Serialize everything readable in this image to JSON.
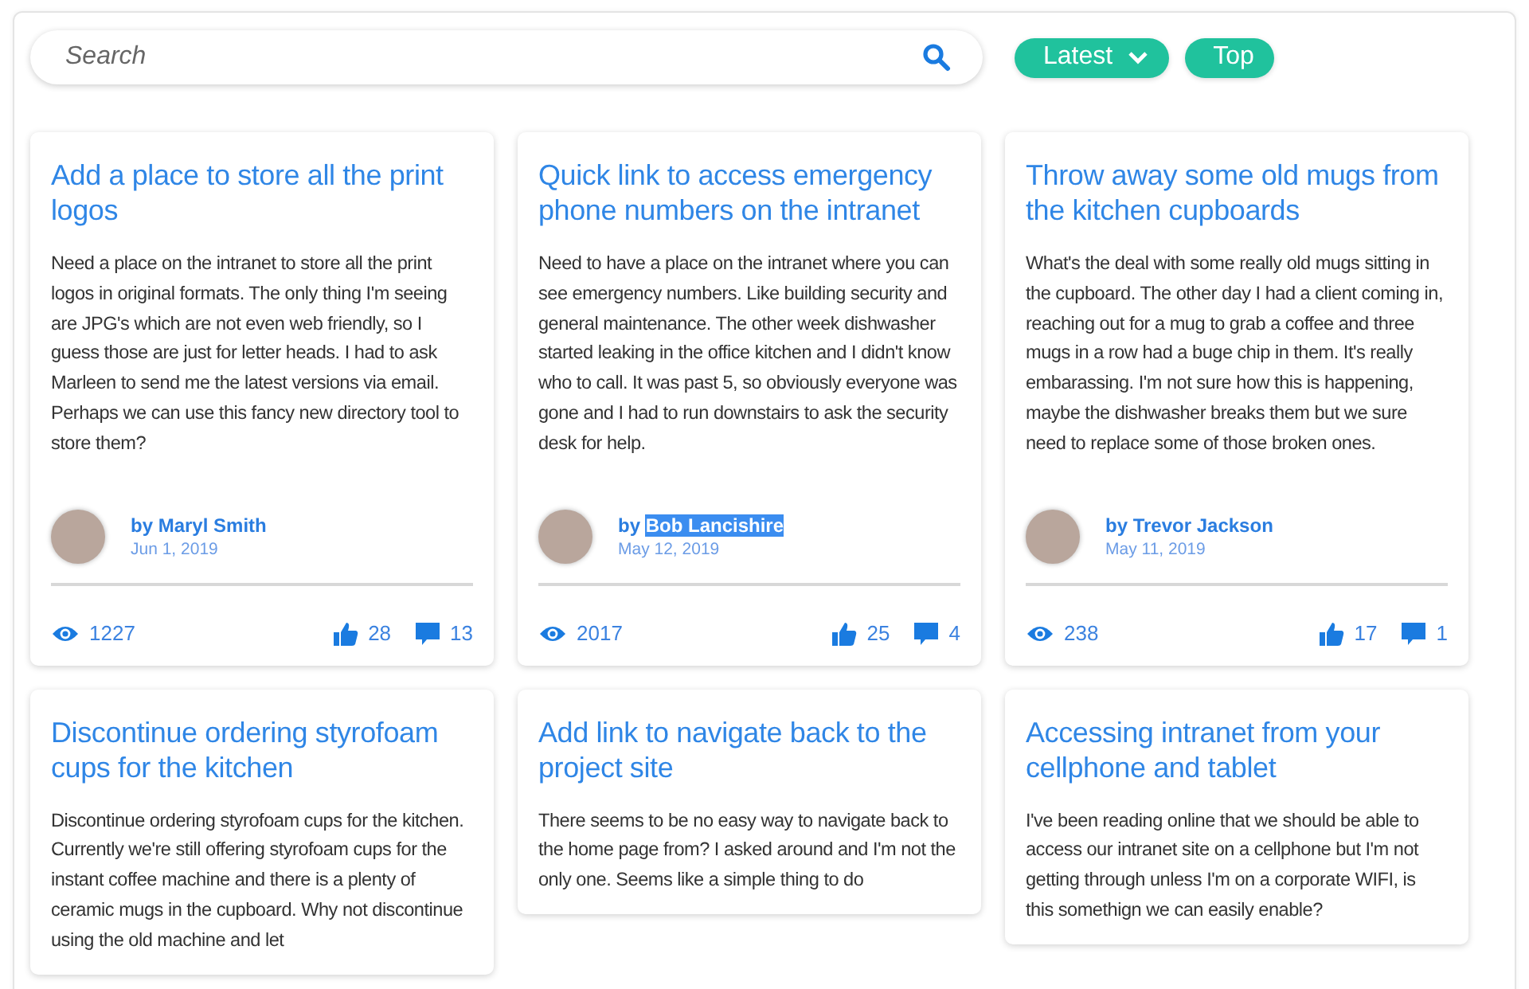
{
  "search": {
    "placeholder": "Search"
  },
  "sort_buttons": [
    {
      "label": "Latest",
      "kind": "dropdown"
    },
    {
      "label": "Top",
      "kind": "plain"
    }
  ],
  "columns": [
    {
      "cards": [
        {
          "title": "Add a place to store all the print logos",
          "body": "Need a place on the intranet to store all the print logos in original formats. The only thing I'm seeing are JPG's which are not even web friendly, so I guess those are just for letter heads. I had to ask Marleen to send me the latest versions via email. Perhaps we can use this fancy new directory tool to store them?",
          "by_label": "by",
          "author": "Maryl Smith",
          "author_highlighted": false,
          "date": "Jun 1, 2019",
          "views": "1227",
          "likes": "28",
          "comments": "13"
        },
        {
          "title": "Discontinue ordering styrofoam cups for the kitchen",
          "body": "Discontinue ordering styrofoam cups for the kitchen. Currently we're still offering styrofoam cups for the instant coffee machine and there is a plenty of ceramic mugs in the cupboard. Why not discontinue using the old machine and let"
        }
      ]
    },
    {
      "cards": [
        {
          "title": "Quick link to access emergency phone numbers on the intranet",
          "body": "Need to have a place on the intranet where you can see emergency numbers. Like building security and general maintenance. The other week dishwasher started leaking in the office kitchen and I didn't know who to call. It was past 5, so obviously everyone was gone and I had to run downstairs to ask the security desk for help.",
          "by_label": "by",
          "author": "Bob Lancishire",
          "author_highlighted": true,
          "date": "May 12, 2019",
          "views": "2017",
          "likes": "25",
          "comments": "4"
        },
        {
          "title": "Add link to navigate back to the project site",
          "body": "There seems to be no easy way to navigate back to the home page from? I asked around and I'm not the only one. Seems like a simple thing to do"
        }
      ]
    },
    {
      "cards": [
        {
          "title": "Throw away some old mugs from the kitchen cupboards",
          "body": "What's the deal with some really old mugs sitting in the cupboard. The other day I had a client coming in, reaching out for a mug to grab a coffee and three mugs in a row had a buge chip in them. It's really embarassing. I'm not sure how this is happening, maybe the dishwasher breaks them but we sure need to replace some of those broken ones.",
          "by_label": "by",
          "author": "Trevor Jackson",
          "author_highlighted": false,
          "date": "May 11, 2019",
          "views": "238",
          "likes": "17",
          "comments": "1"
        },
        {
          "title": "Accessing intranet from your cellphone and tablet",
          "body": "I've been reading online that we should be able to access our intranet site on a cellphone but I'm not getting through unless I'm on a corporate WIFI, is this somethign we can easily enable?"
        }
      ]
    }
  ]
}
